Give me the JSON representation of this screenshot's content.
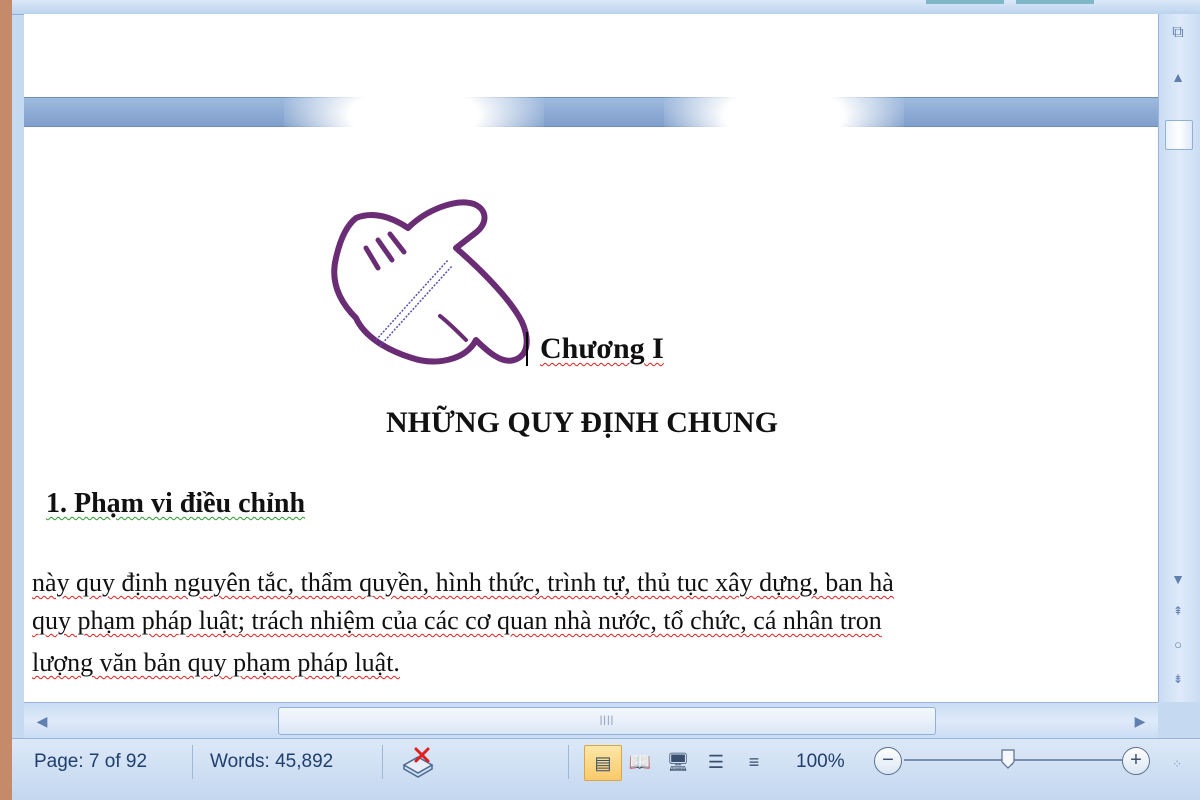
{
  "document": {
    "chapter": "Chương I",
    "section_title": "NHỮNG QUY ĐỊNH CHUNG",
    "article_heading": "1. Phạm vi điều chỉnh",
    "paragraph_lines": [
      "này quy định nguyên tắc, thẩm quyền, hình thức, trình tự, thủ tục xây dựng, ban hà",
      "quy phạm pháp luật; trách nhiệm của các cơ quan nhà nước, tổ chức, cá nhân tron",
      "lượng văn bản quy phạm pháp luật."
    ]
  },
  "status": {
    "page": "Page: 7 of 92",
    "words": "Words: 45,892",
    "zoom": "100%",
    "zoom_minus": "−",
    "zoom_plus": "+",
    "zoom_level_fraction": 0.5
  },
  "views": [
    "Print Layout",
    "Full Screen Reading",
    "Web Layout",
    "Outline",
    "Draft"
  ],
  "active_view": "Print Layout",
  "icons": {
    "pointer": "hand-pointer-icon",
    "proofing": "proofing-icon",
    "split": "split-window-icon",
    "prev": "previous-page-icon",
    "browse": "select-browse-object-icon",
    "next": "next-page-icon"
  },
  "colors": {
    "chrome": "#c5d9f1",
    "hand_outline": "#6a2c74",
    "spell_error": "#e02020",
    "grammar_error": "#2a9a2a",
    "active_view": "#f9c96b"
  }
}
